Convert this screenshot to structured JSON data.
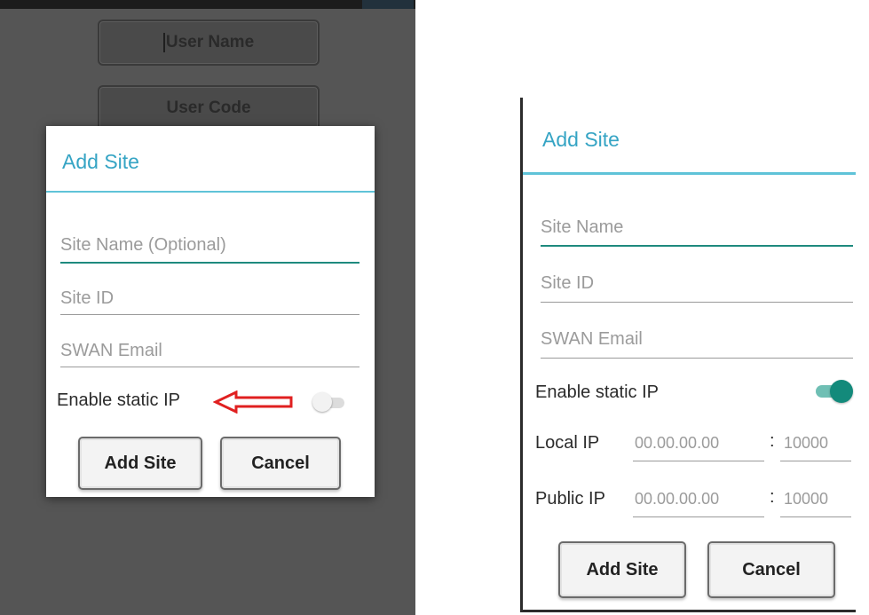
{
  "left": {
    "background_fields": {
      "user_name": "User Name",
      "user_code": "User Code"
    },
    "dialog": {
      "title": "Add Site",
      "fields": {
        "site_name_placeholder": "Site Name (Optional)",
        "site_id_placeholder": "Site ID",
        "swan_email_placeholder": "SWAN Email"
      },
      "static_ip_label": "Enable static IP",
      "static_ip_enabled": false,
      "add_button": "Add Site",
      "cancel_button": "Cancel"
    }
  },
  "right": {
    "dialog": {
      "title": "Add Site",
      "fields": {
        "site_name_placeholder": "Site Name",
        "site_id_placeholder": "Site ID",
        "swan_email_placeholder": "SWAN Email"
      },
      "static_ip_label": "Enable static IP",
      "static_ip_enabled": true,
      "local_ip_label": "Local IP",
      "local_ip_value": "00.00.00.00",
      "local_port": "10000",
      "public_ip_label": "Public IP",
      "public_ip_value": "00.00.00.00",
      "public_port": "10000",
      "colon": ":",
      "add_button": "Add Site",
      "cancel_button": "Cancel"
    }
  },
  "colors": {
    "title_accent": "#35a4c4",
    "focused_underline": "#1e8a7e",
    "toggle_on": "#138a7b",
    "annotation_arrow": "#e02020"
  },
  "icons": {
    "annotation": "left-arrow-icon"
  }
}
